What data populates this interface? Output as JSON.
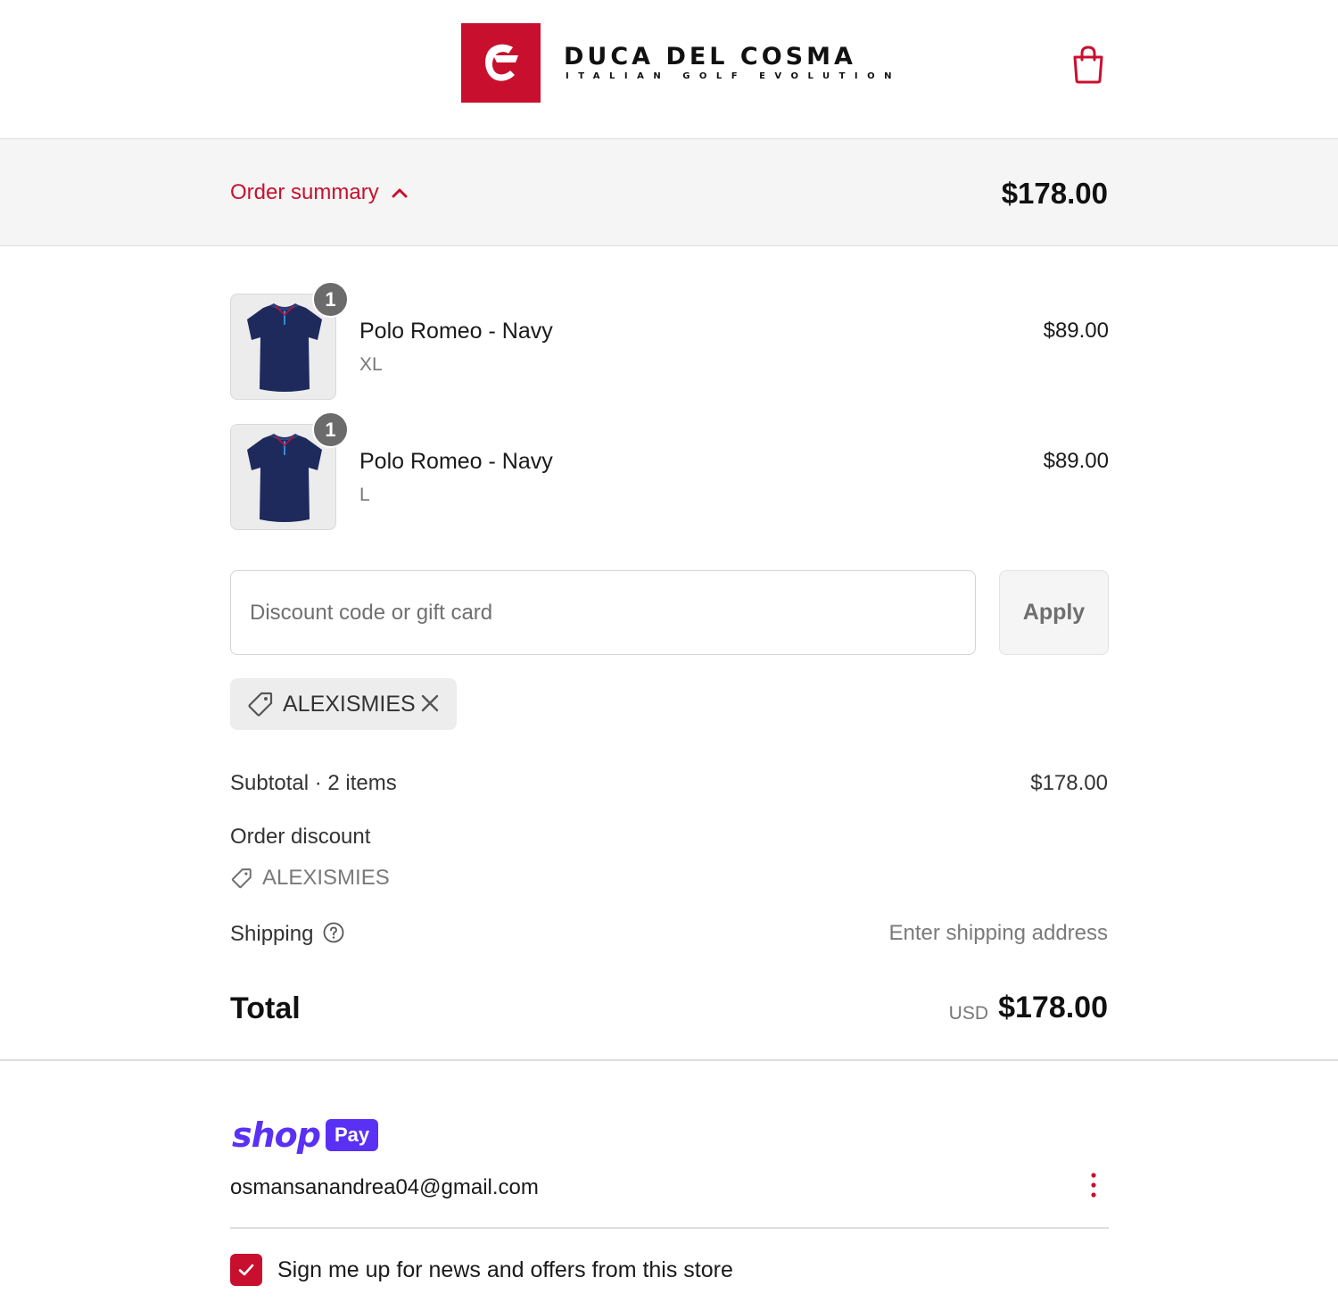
{
  "header": {
    "brand_name": "DUCA DEL COSMA",
    "brand_tagline": "ITALIAN GOLF EVOLUTION",
    "logo_icon": "dc-monogram-logo",
    "cart_icon": "shopping-bag-icon"
  },
  "summary_bar": {
    "toggle_label": "Order summary",
    "toggle_icon": "chevron-up-icon",
    "total": "$178.00"
  },
  "line_items": [
    {
      "quantity": "1",
      "title": "Polo Romeo - Navy",
      "variant": "XL",
      "price": "$89.00"
    },
    {
      "quantity": "1",
      "title": "Polo Romeo - Navy",
      "variant": "L",
      "price": "$89.00"
    }
  ],
  "discount": {
    "placeholder": "Discount code or gift card",
    "value": "",
    "apply_label": "Apply",
    "applied_code": "ALEXISMIES"
  },
  "costs": {
    "subtotal_label": "Subtotal · 2 items",
    "subtotal_value": "$178.00",
    "discount_label": "Order discount",
    "discount_code": "ALEXISMIES",
    "shipping_label": "Shipping",
    "shipping_value": "Enter shipping address",
    "total_label": "Total",
    "total_currency": "USD",
    "total_value": "$178.00"
  },
  "shop_pay": {
    "wordmark": "shop",
    "pill": "Pay",
    "email": "osmansanandrea04@gmail.com"
  },
  "newsletter": {
    "checked": true,
    "label": "Sign me up for news and offers from this store"
  },
  "colors": {
    "accent": "#c8102e",
    "shop_pay": "#5a31f4",
    "summary_bg": "#f5f5f5",
    "product_navy": "#1f2a5c"
  }
}
